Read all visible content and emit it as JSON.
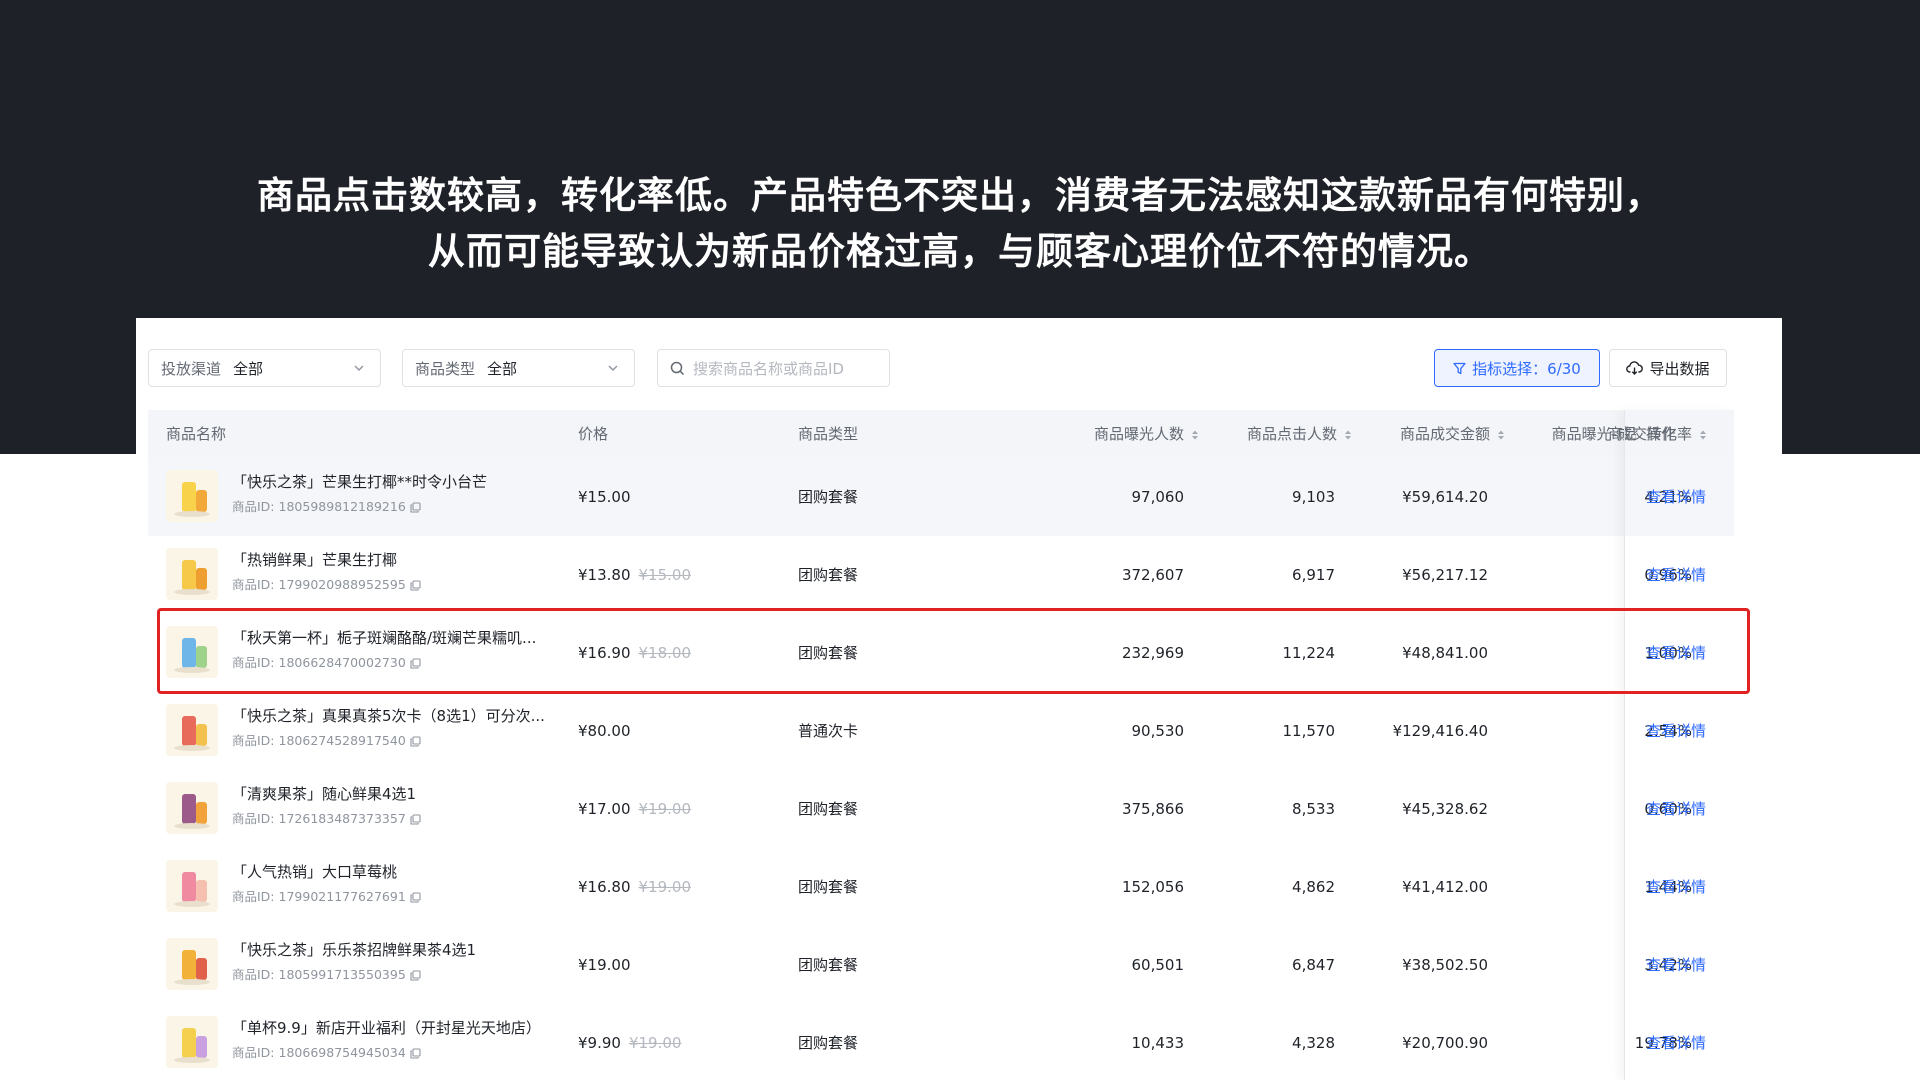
{
  "headline": {
    "line1": "商品点击数较高，转化率低。产品特色不突出，消费者无法感知这款新品有何特别，",
    "line2": "从而可能导致认为新品价格过高，与顾客心理价位不符的情况。"
  },
  "filters": {
    "channel_label": "投放渠道",
    "channel_value": "全部",
    "type_label": "商品类型",
    "type_value": "全部",
    "search_placeholder": "搜索商品名称或商品ID"
  },
  "toolbar": {
    "metric_button": "指标选择：6/30",
    "export_button": "导出数据"
  },
  "table": {
    "headers": {
      "name": "商品名称",
      "price": "价格",
      "type": "商品类型",
      "exposure": "商品曝光人数",
      "clicks": "商品点击人数",
      "gmv": "商品成交金额",
      "conversion": "商品曝光-成交转化率",
      "more": "商品",
      "action": "操作"
    },
    "id_prefix": "商品ID: ",
    "action_label": "查看详情",
    "rows": [
      {
        "name": "「快乐之茶」芒果生打椰**时令小台芒",
        "id": "1805989812189216",
        "price": "¥15.00",
        "orig_price": "",
        "type": "团购套餐",
        "exposure": "97,060",
        "clicks": "9,103",
        "gmv": "¥59,614.20",
        "conversion": "4.21%"
      },
      {
        "name": "「热销鲜果」芒果生打椰",
        "id": "1799020988952595",
        "price": "¥13.80",
        "orig_price": "¥15.00",
        "type": "团购套餐",
        "exposure": "372,607",
        "clicks": "6,917",
        "gmv": "¥56,217.12",
        "conversion": "0.96%"
      },
      {
        "name": "「秋天第一杯」栀子斑斓酪酪/斑斓芒果糯叽...",
        "id": "1806628470002730",
        "price": "¥16.90",
        "orig_price": "¥18.00",
        "type": "团购套餐",
        "exposure": "232,969",
        "clicks": "11,224",
        "gmv": "¥48,841.00",
        "conversion": "1.00%"
      },
      {
        "name": "「快乐之茶」真果真茶5次卡（8选1）可分次...",
        "id": "1806274528917540",
        "price": "¥80.00",
        "orig_price": "",
        "type": "普通次卡",
        "exposure": "90,530",
        "clicks": "11,570",
        "gmv": "¥129,416.40",
        "conversion": "2.54%"
      },
      {
        "name": "「清爽果茶」随心鲜果4选1",
        "id": "1726183487373357",
        "price": "¥17.00",
        "orig_price": "¥19.00",
        "type": "团购套餐",
        "exposure": "375,866",
        "clicks": "8,533",
        "gmv": "¥45,328.62",
        "conversion": "0.60%"
      },
      {
        "name": "「人气热销」大口草莓桃",
        "id": "1799021177627691",
        "price": "¥16.80",
        "orig_price": "¥19.00",
        "type": "团购套餐",
        "exposure": "152,056",
        "clicks": "4,862",
        "gmv": "¥41,412.00",
        "conversion": "1.44%"
      },
      {
        "name": "「快乐之茶」乐乐茶招牌鲜果茶4选1",
        "id": "1805991713550395",
        "price": "¥19.00",
        "orig_price": "",
        "type": "团购套餐",
        "exposure": "60,501",
        "clicks": "6,847",
        "gmv": "¥38,502.50",
        "conversion": "3.42%"
      },
      {
        "name": "「单杯9.9」新店开业福利（开封星光天地店）",
        "id": "1806698754945034",
        "price": "¥9.90",
        "orig_price": "¥19.00",
        "type": "团购套餐",
        "exposure": "10,433",
        "clicks": "4,328",
        "gmv": "¥20,700.90",
        "conversion": "19.78%"
      }
    ]
  },
  "colors": {
    "dark_background": "#1e2128",
    "accent_blue": "#2f6bff",
    "highlight_red": "#e02222"
  },
  "icons": [
    "chevron-down-icon",
    "search-icon",
    "filter-icon",
    "cloud-download-icon",
    "copy-icon",
    "sort-icon"
  ]
}
